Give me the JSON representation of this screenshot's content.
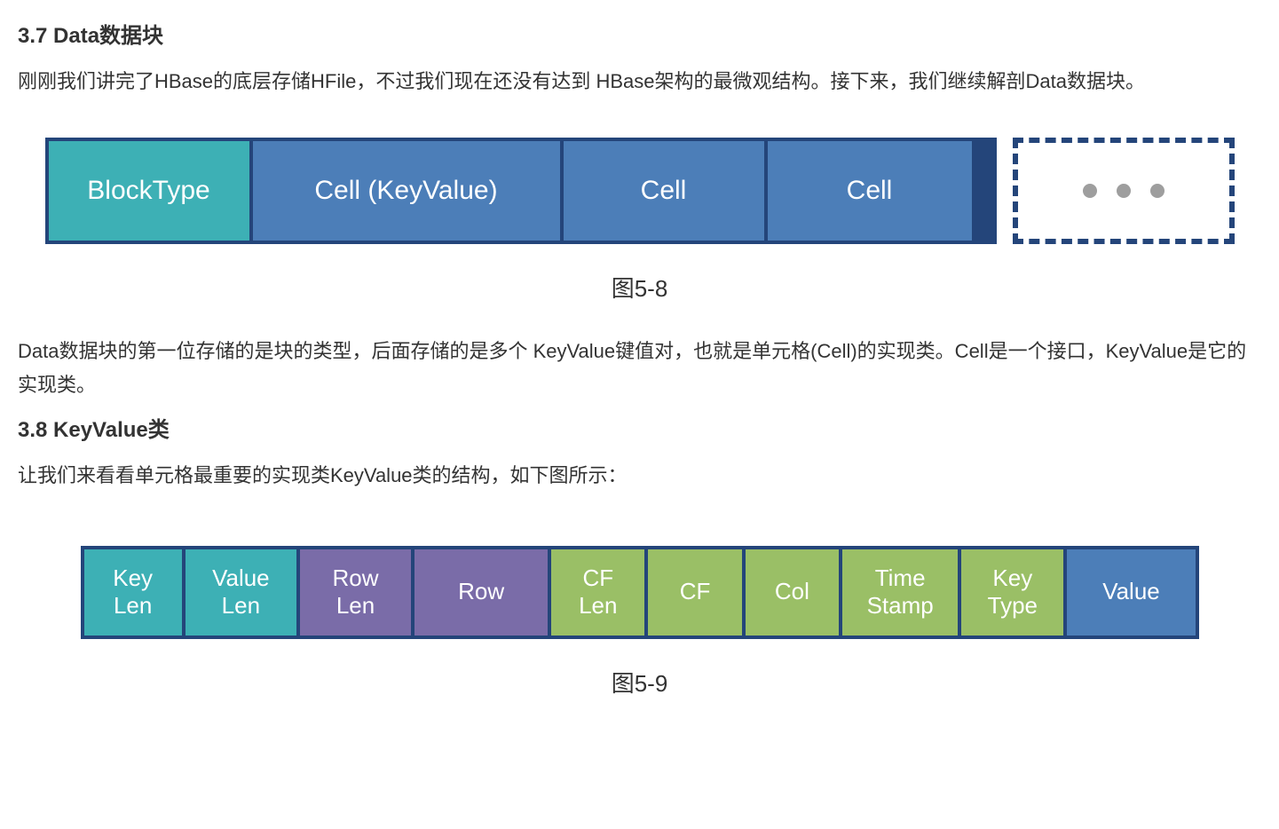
{
  "section1": {
    "heading": "3.7 Data数据块",
    "para": "刚刚我们讲完了HBase的底层存储HFile，不过我们现在还没有达到 HBase架构的最微观结构。接下来，我们继续解剖Data数据块。"
  },
  "fig58": {
    "caption": "图5-8",
    "blocktype": "BlockType",
    "cellkv": "Cell (KeyValue)",
    "cell": "Cell"
  },
  "para2": "Data数据块的第一位存储的是块的类型，后面存储的是多个 KeyValue键值对，也就是单元格(Cell)的实现类。Cell是一个接口，KeyValue是它的实现类。",
  "section2": {
    "heading": "3.8 KeyValue类",
    "para": "让我们来看看单元格最重要的实现类KeyValue类的结构，如下图所示："
  },
  "fig59": {
    "caption": "图5-9",
    "cells": {
      "keylen": "Key\nLen",
      "vallen": "Value\nLen",
      "rowlen": "Row\nLen",
      "row": "Row",
      "cflen": "CF\nLen",
      "cf": "CF",
      "col": "Col",
      "ts": "Time\nStamp",
      "keytype": "Key\nType",
      "value": "Value"
    }
  },
  "chart_data": [
    {
      "type": "table",
      "title": "图5-8  Data数据块结构",
      "columns": [
        "BlockType",
        "Cell (KeyValue)",
        "Cell",
        "Cell",
        "..."
      ]
    },
    {
      "type": "table",
      "title": "图5-9  KeyValue类结构",
      "columns": [
        "Key Len",
        "Value Len",
        "Row Len",
        "Row",
        "CF Len",
        "CF",
        "Col",
        "Time Stamp",
        "Key Type",
        "Value"
      ],
      "color_groups": {
        "teal": [
          "Key Len",
          "Value Len"
        ],
        "purple": [
          "Row Len",
          "Row"
        ],
        "green": [
          "CF Len",
          "CF",
          "Col",
          "Time Stamp",
          "Key Type"
        ],
        "blue": [
          "Value"
        ]
      }
    }
  ]
}
